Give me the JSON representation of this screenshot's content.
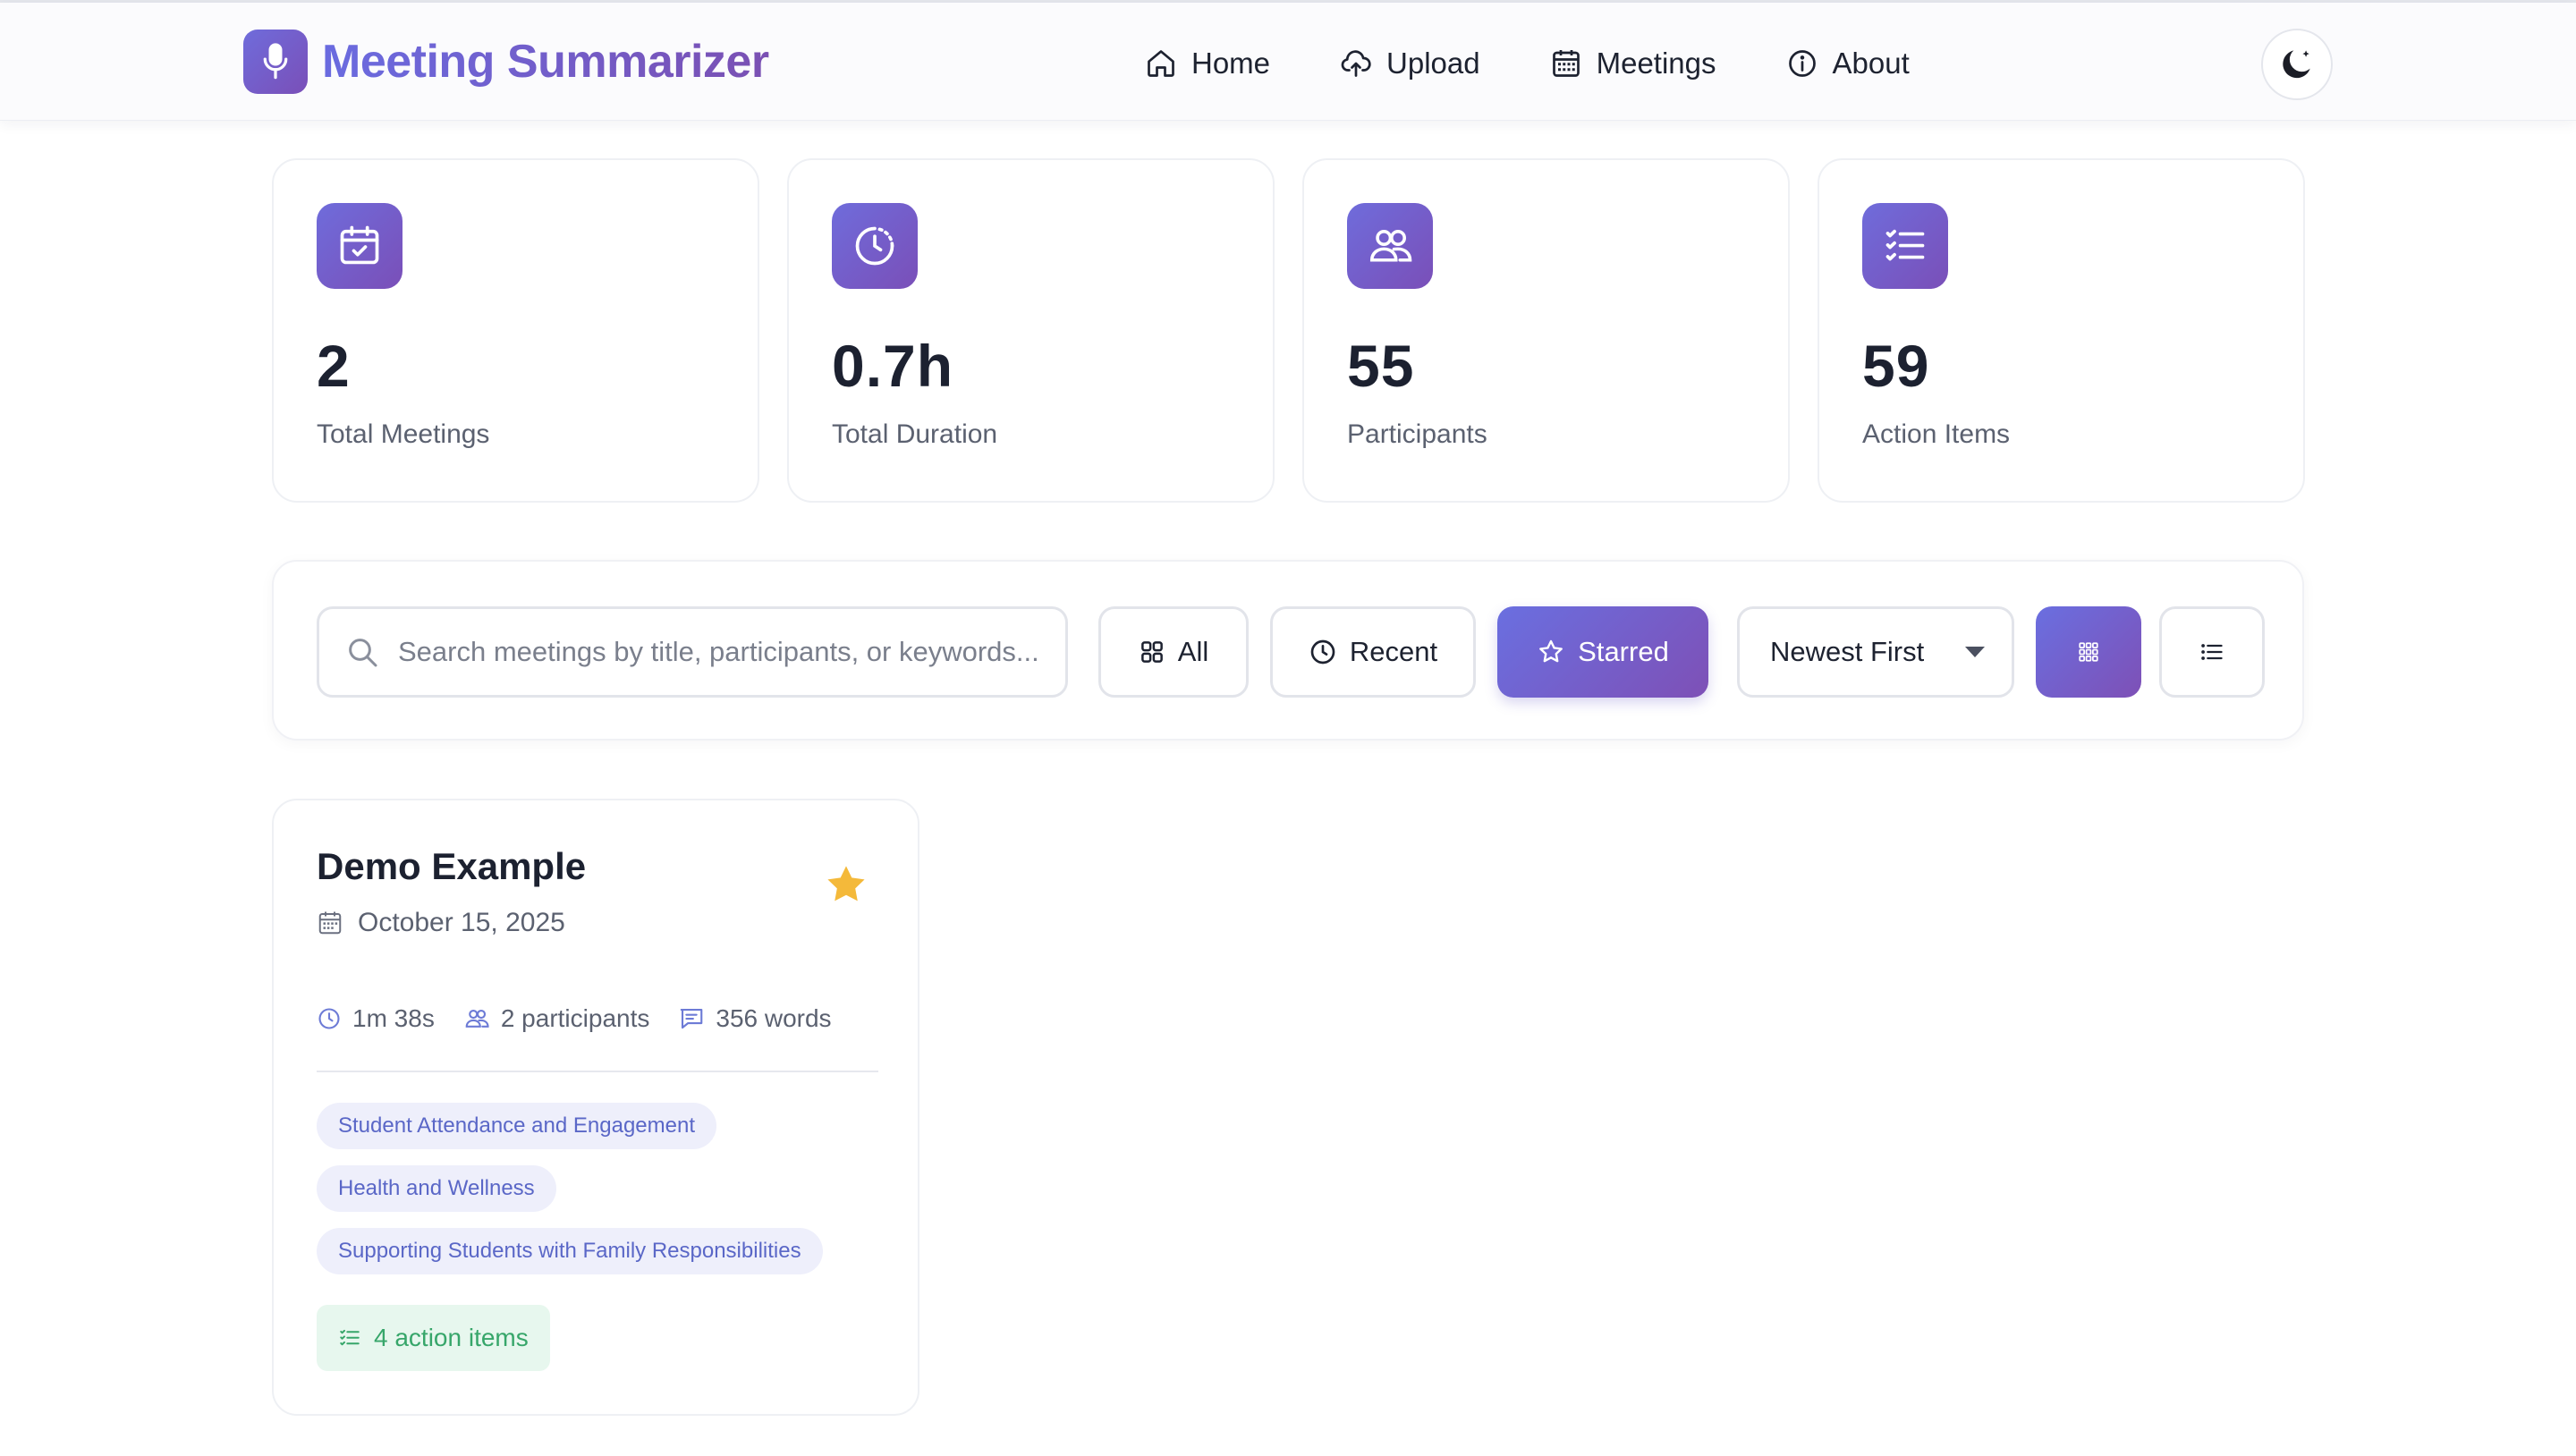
{
  "app": {
    "title": "Meeting Summarizer",
    "accent_start": "#6f6cdb",
    "accent_end": "#7a4fb8",
    "logo_icon": "microphone-icon"
  },
  "nav": {
    "items": [
      {
        "label": "Home",
        "icon": "home-icon"
      },
      {
        "label": "Upload",
        "icon": "cloud-upload-icon"
      },
      {
        "label": "Meetings",
        "icon": "calendar-icon"
      },
      {
        "label": "About",
        "icon": "info-icon"
      }
    ],
    "theme_toggle_icon": "moon-icon"
  },
  "stats": [
    {
      "value": "2",
      "label": "Total Meetings",
      "icon": "calendar-check-icon"
    },
    {
      "value": "0.7h",
      "label": "Total Duration",
      "icon": "clock-icon"
    },
    {
      "value": "55",
      "label": "Participants",
      "icon": "users-icon"
    },
    {
      "value": "59",
      "label": "Action Items",
      "icon": "list-check-icon"
    }
  ],
  "toolbar": {
    "search_placeholder": "Search meetings by title, participants, or keywords...",
    "search_value": "",
    "filters": [
      {
        "label": "All",
        "icon": "grid-icon",
        "active": false
      },
      {
        "label": "Recent",
        "icon": "clock-icon",
        "active": false
      },
      {
        "label": "Starred",
        "icon": "star-icon",
        "active": true
      }
    ],
    "sort_selected": "Newest First",
    "view_modes": [
      {
        "name": "grid",
        "icon": "grid-view-icon",
        "active": true
      },
      {
        "name": "list",
        "icon": "list-view-icon",
        "active": false
      }
    ]
  },
  "meetings": [
    {
      "title": "Demo Example",
      "starred": true,
      "star_color": "#f4b93a",
      "date": "October 15, 2025",
      "duration": "1m 38s",
      "participants": "2 participants",
      "words": "356 words",
      "tags": [
        "Student Attendance and Engagement",
        "Health and Wellness",
        "Supporting Students with Family Responsibilities"
      ],
      "action_items": "4 action items",
      "action_color": "#37a66a"
    }
  ]
}
